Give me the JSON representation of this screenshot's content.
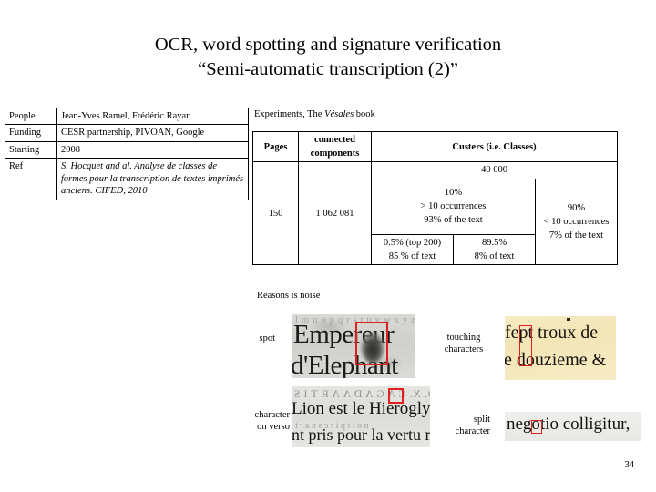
{
  "title": {
    "line1": "OCR, word spotting and signature verification",
    "line2": "“Semi-automatic transcription (2)”"
  },
  "info_table": {
    "rows": [
      {
        "key": "People",
        "value": "Jean-Yves Ramel, Frédéric Rayar"
      },
      {
        "key": "Funding",
        "value": "CESR partnership, PIVOAN, Google"
      },
      {
        "key": "Starting",
        "value": "2008"
      },
      {
        "key": "Ref",
        "value": "S. Hocquet and al.  Analyse de classes de formes pour la transcription de textes imprimés anciens. CIFED, 2010"
      }
    ]
  },
  "experiments": {
    "caption_pre": "Experiments, The ",
    "caption_italic": "Vésales",
    "caption_post": " book",
    "headers": {
      "pages": "Pages",
      "connected_components": "connected components",
      "clusters": "Custers (i.e. Classes)"
    },
    "values": {
      "pages": "150",
      "connected_components": "1 062 081",
      "clusters_total": "40 000",
      "group_frequent": {
        "share": "10%",
        "occurrences": "> 10 occurrences",
        "text_coverage": "93% of the text",
        "sub_top": {
          "share": "0.5% (top 200)",
          "text_coverage": "85 % of text"
        },
        "sub_rest": {
          "share": "89.5%",
          "text_coverage": "8% of text"
        }
      },
      "group_rare": {
        "share": "90%",
        "occurrences": "< 10 occurrences",
        "text_coverage": "7% of the text"
      }
    }
  },
  "reasons": {
    "label": "Reasons is noise"
  },
  "figures": {
    "spot": {
      "label": "spot",
      "scan_line1": "Empereur",
      "scan_line2": "d'Elephant",
      "scan_ghost": "l m n o p q r s t u v w x y z"
    },
    "verso": {
      "label_line1": "character",
      "label_line2": "on verso",
      "scan_line1": "Lion est  le Hieroglyp",
      "scan_line2": "nt pris pour la vertu m",
      "scan_mirror1": "D. X. C A G A D A Α R T I S",
      "scan_mirror2": "n o i t p i r c s n a r t"
    },
    "touching": {
      "label_line1": "touching",
      "label_line2": "characters",
      "scan_line1": "fept troux de",
      "scan_line2": "e douzieme &"
    },
    "split": {
      "label_line1": "split",
      "label_line2": "character",
      "scan_line1": "negotio colligitur,"
    }
  },
  "page_number": "34",
  "colors": {
    "highlight_box": "#e02020",
    "background": "#ffffff",
    "text": "#000000",
    "parchment": "#f4e7ba"
  }
}
